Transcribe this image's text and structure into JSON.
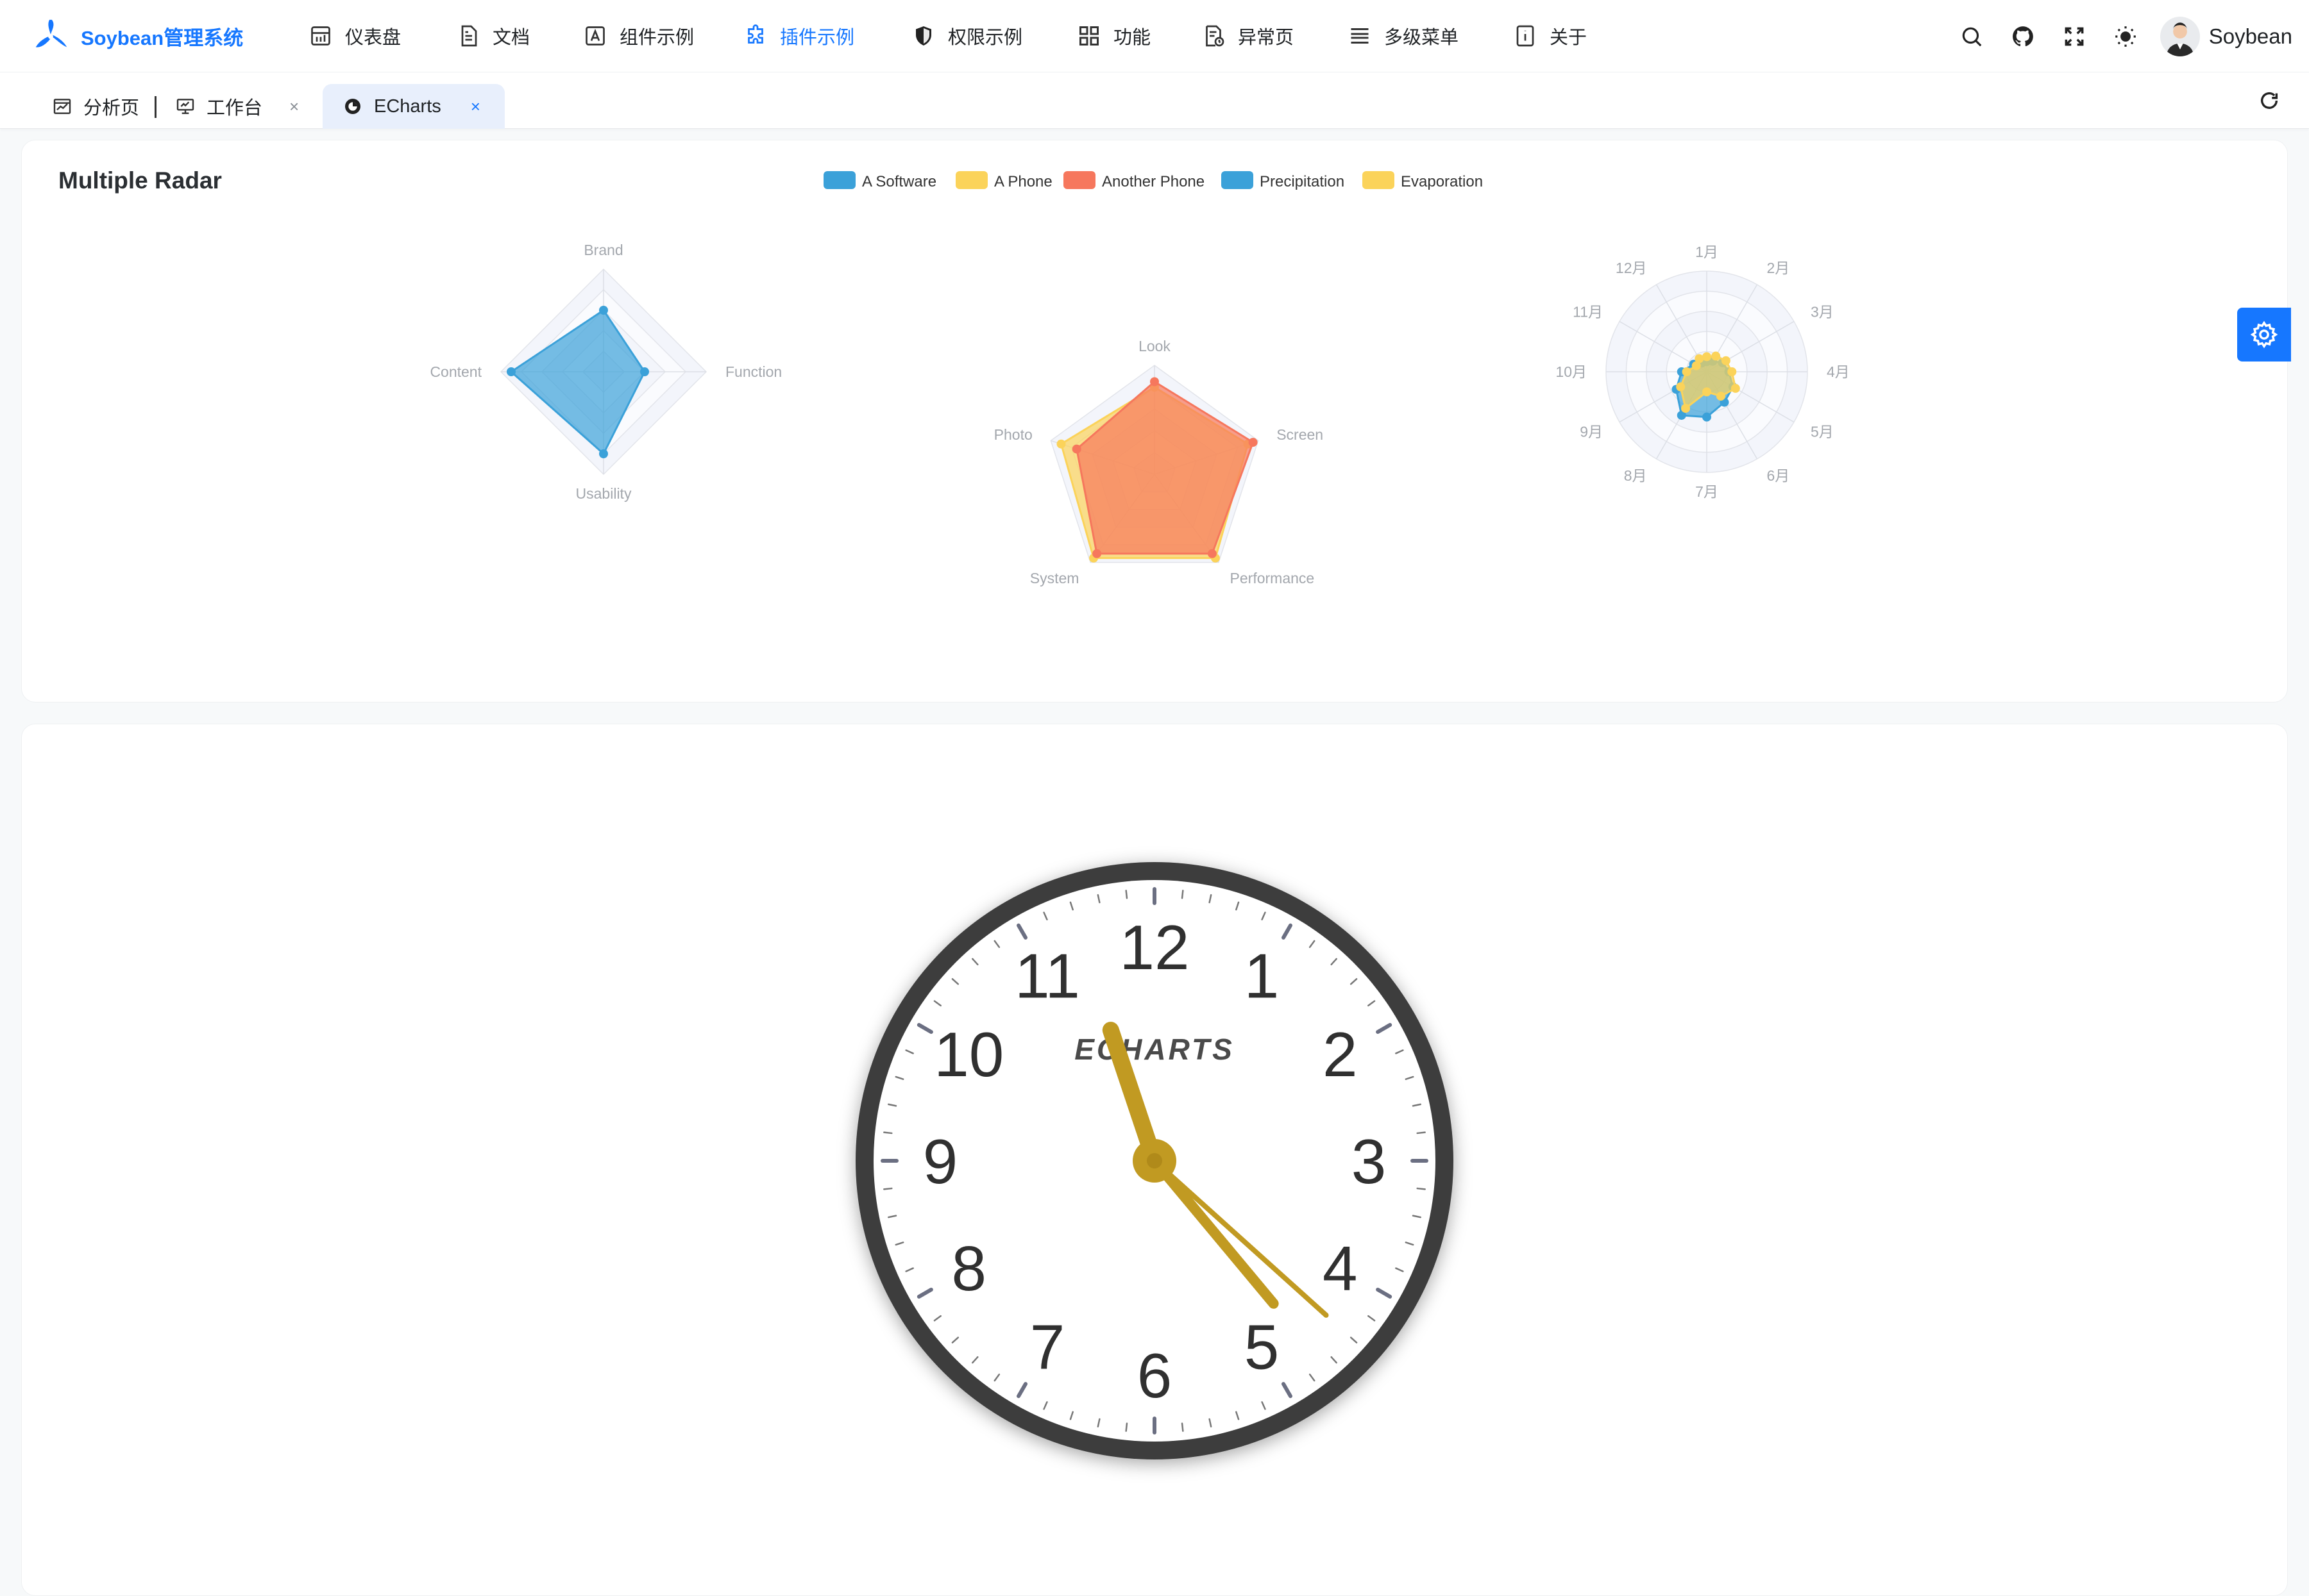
{
  "app": {
    "title": "Soybean管理系统"
  },
  "nav": [
    {
      "label": "仪表盘",
      "icon": "dashboard-icon"
    },
    {
      "label": "文档",
      "icon": "document-icon"
    },
    {
      "label": "组件示例",
      "icon": "component-icon"
    },
    {
      "label": "插件示例",
      "icon": "plugin-icon",
      "active": true
    },
    {
      "label": "权限示例",
      "icon": "shield-icon"
    },
    {
      "label": "功能",
      "icon": "grid-icon"
    },
    {
      "label": "异常页",
      "icon": "exception-icon"
    },
    {
      "label": "多级菜单",
      "icon": "menu-icon"
    },
    {
      "label": "关于",
      "icon": "info-icon"
    }
  ],
  "header_actions": [
    "search-icon",
    "github-icon",
    "fullscreen-icon",
    "theme-icon"
  ],
  "user": {
    "name": "Soybean"
  },
  "tabs": [
    {
      "label": "分析页",
      "icon": "analysis-icon",
      "closable": false
    },
    {
      "label": "工作台",
      "icon": "workbench-icon",
      "closable": true,
      "close": "×"
    },
    {
      "label": "ECharts",
      "icon": "echarts-icon",
      "closable": true,
      "active": true,
      "close": "×"
    }
  ],
  "accent_color": "#1677ff",
  "radar_card": {
    "title": "Multiple Radar",
    "legend": [
      {
        "name": "A Software",
        "color": "#3ba1d9"
      },
      {
        "name": "A Phone",
        "color": "#fbd35a"
      },
      {
        "name": "Another Phone",
        "color": "#f6775d"
      },
      {
        "name": "Precipitation",
        "color": "#3ba1d9"
      },
      {
        "name": "Evaporation",
        "color": "#fbd35a"
      }
    ]
  },
  "chart_data": [
    {
      "type": "radar",
      "indicators": [
        "Brand",
        "Function",
        "Usability",
        "Content"
      ],
      "max": 100,
      "series": [
        {
          "name": "A Software",
          "values": [
            60,
            40,
            80,
            90
          ],
          "color": "#3ba1d9"
        }
      ]
    },
    {
      "type": "radar",
      "indicators": [
        "Look",
        "Screen",
        "Performance",
        "System",
        "Photo"
      ],
      "max": 100,
      "series": [
        {
          "name": "A Phone",
          "values": [
            80,
            90,
            95,
            95,
            90
          ],
          "color": "#fbd35a"
        },
        {
          "name": "Another Phone",
          "values": [
            85,
            95,
            90,
            90,
            75
          ],
          "color": "#f6775d"
        }
      ]
    },
    {
      "type": "radar",
      "indicators": [
        "1月",
        "2月",
        "3月",
        "4月",
        "5月",
        "6月",
        "7月",
        "8月",
        "9月",
        "10月",
        "11月",
        "12月"
      ],
      "max": 100,
      "series": [
        {
          "name": "Precipitation",
          "values": [
            10,
            12,
            18,
            22,
            30,
            35,
            45,
            50,
            35,
            25,
            15,
            10
          ],
          "color": "#3ba1d9"
        },
        {
          "name": "Evaporation",
          "values": [
            15,
            18,
            22,
            25,
            33,
            28,
            20,
            42,
            30,
            20,
            12,
            15
          ],
          "color": "#fbd35a"
        }
      ]
    }
  ],
  "clock": {
    "brand": "ECHARTS",
    "numbers": [
      "12",
      "1",
      "2",
      "3",
      "4",
      "5",
      "6",
      "7",
      "8",
      "9",
      "10",
      "11"
    ],
    "hour": 11,
    "minute": 23,
    "second": 22,
    "hand_color": "#c19a22"
  }
}
